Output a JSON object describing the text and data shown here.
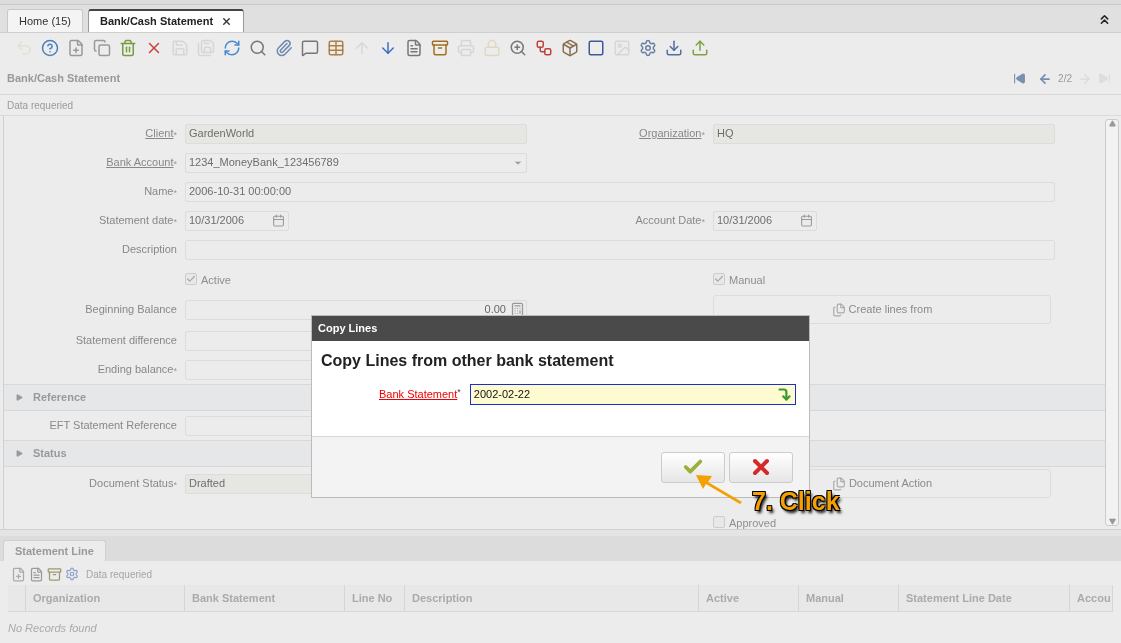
{
  "tabs": [
    {
      "label": "Home (15)",
      "selected": false,
      "closable": false
    },
    {
      "label": "Bank/Cash Statement",
      "selected": true,
      "closable": true
    }
  ],
  "toolbar": [
    {
      "disabled": true
    },
    {
      "disabled": false
    },
    {
      "disabled": false
    },
    {
      "disabled": false
    },
    {
      "disabled": false
    },
    {
      "disabled": false
    },
    {
      "disabled": true
    },
    {
      "disabled": true
    },
    {
      "disabled": false
    },
    {
      "disabled": false
    },
    {
      "disabled": false
    },
    {
      "disabled": false
    },
    {
      "disabled": false
    },
    {
      "disabled": true
    },
    {
      "disabled": false
    },
    {
      "disabled": false
    },
    {
      "disabled": false
    },
    {
      "disabled": true
    },
    {
      "disabled": true
    },
    {
      "disabled": false
    },
    {
      "disabled": false
    },
    {
      "disabled": false
    },
    {
      "disabled": false
    },
    {
      "disabled": true
    },
    {
      "disabled": false
    },
    {
      "disabled": false
    },
    {
      "disabled": false
    }
  ],
  "window_title": "Bank/Cash Statement",
  "navigation": {
    "position": "2/2",
    "first_disabled": false,
    "previous_disabled": false,
    "next_disabled": true,
    "last_disabled": true
  },
  "status_message": "Data requeried",
  "form": [
    {
      "kind": "row",
      "cells": [
        {
          "kind": "readonly",
          "label": "Client",
          "required_mark": "*",
          "link": true,
          "value": "GardenWorld"
        },
        {
          "kind": "readonly",
          "label": "Organization",
          "required_mark": "*",
          "link": true,
          "value": "HQ"
        }
      ]
    },
    {
      "kind": "row",
      "cells": [
        {
          "kind": "select",
          "label": "Bank Account",
          "required_mark": "*",
          "link": true,
          "value": "1234_MoneyBank_123456789"
        }
      ]
    },
    {
      "kind": "row",
      "cells": [
        {
          "kind": "wide",
          "label": "Name",
          "required_mark": "*",
          "link": false,
          "value": "2006-10-31 00:00:00"
        }
      ]
    },
    {
      "kind": "row",
      "cells": [
        {
          "kind": "date",
          "label": "Statement date",
          "required_mark": "*",
          "link": false,
          "value": "10/31/2006"
        },
        {
          "kind": "date",
          "label": "Account Date",
          "required_mark": "*",
          "link": false,
          "value": "10/31/2006"
        }
      ]
    },
    {
      "kind": "row",
      "cells": [
        {
          "kind": "wide",
          "label": "Description",
          "link": false
        }
      ]
    },
    {
      "kind": "row",
      "cells": [
        {
          "kind": "checkbox",
          "label": "Active",
          "checked": true
        },
        {
          "kind": "checkbox",
          "label": "Manual",
          "checked": true
        }
      ]
    },
    {
      "kind": "row",
      "cells": [
        {
          "kind": "number",
          "label": "Beginning Balance",
          "link": false,
          "value": "0.00"
        },
        {
          "kind": "button",
          "label": "Create lines from"
        }
      ]
    },
    {
      "kind": "row",
      "cells": [
        {
          "kind": "text",
          "label": "Statement difference",
          "link": false
        }
      ]
    },
    {
      "kind": "row",
      "cells": [
        {
          "kind": "text",
          "label": "Ending balance",
          "required_mark": "*",
          "link": false
        }
      ]
    },
    {
      "kind": "section",
      "label": "Reference",
      "expanded": true
    },
    {
      "kind": "row",
      "cells": [
        {
          "kind": "text",
          "label": "EFT Statement Reference",
          "link": false
        }
      ]
    },
    {
      "kind": "section",
      "label": "Status",
      "expanded": true
    },
    {
      "kind": "row",
      "cells": [
        {
          "kind": "readonly",
          "label": "Document Status",
          "required_mark": "*",
          "link": false,
          "value": "Drafted"
        },
        {
          "kind": "button",
          "label": "Document Action"
        }
      ]
    },
    {
      "kind": "row",
      "cells": [
        null,
        {
          "kind": "checkbox",
          "label": "Approved",
          "checked": false
        }
      ]
    }
  ],
  "detail": {
    "tab": "Statement Line",
    "status_message": "Data requeried",
    "columns": [
      "Organization",
      "Bank Statement",
      "Line No",
      "Description",
      "Active",
      "Manual",
      "Statement Line Date",
      "Accou"
    ],
    "empty_message": "No Records found"
  },
  "dialog": {
    "title": "Copy Lines",
    "heading": "Copy Lines from other bank statement",
    "field": {
      "label": "Bank Statement",
      "required_mark": "*",
      "value": "2002-02-22"
    },
    "buttons": [
      {
        "kind": "ok"
      },
      {
        "kind": "cancel"
      }
    ]
  },
  "annotation": {
    "text": "7. Click"
  }
}
